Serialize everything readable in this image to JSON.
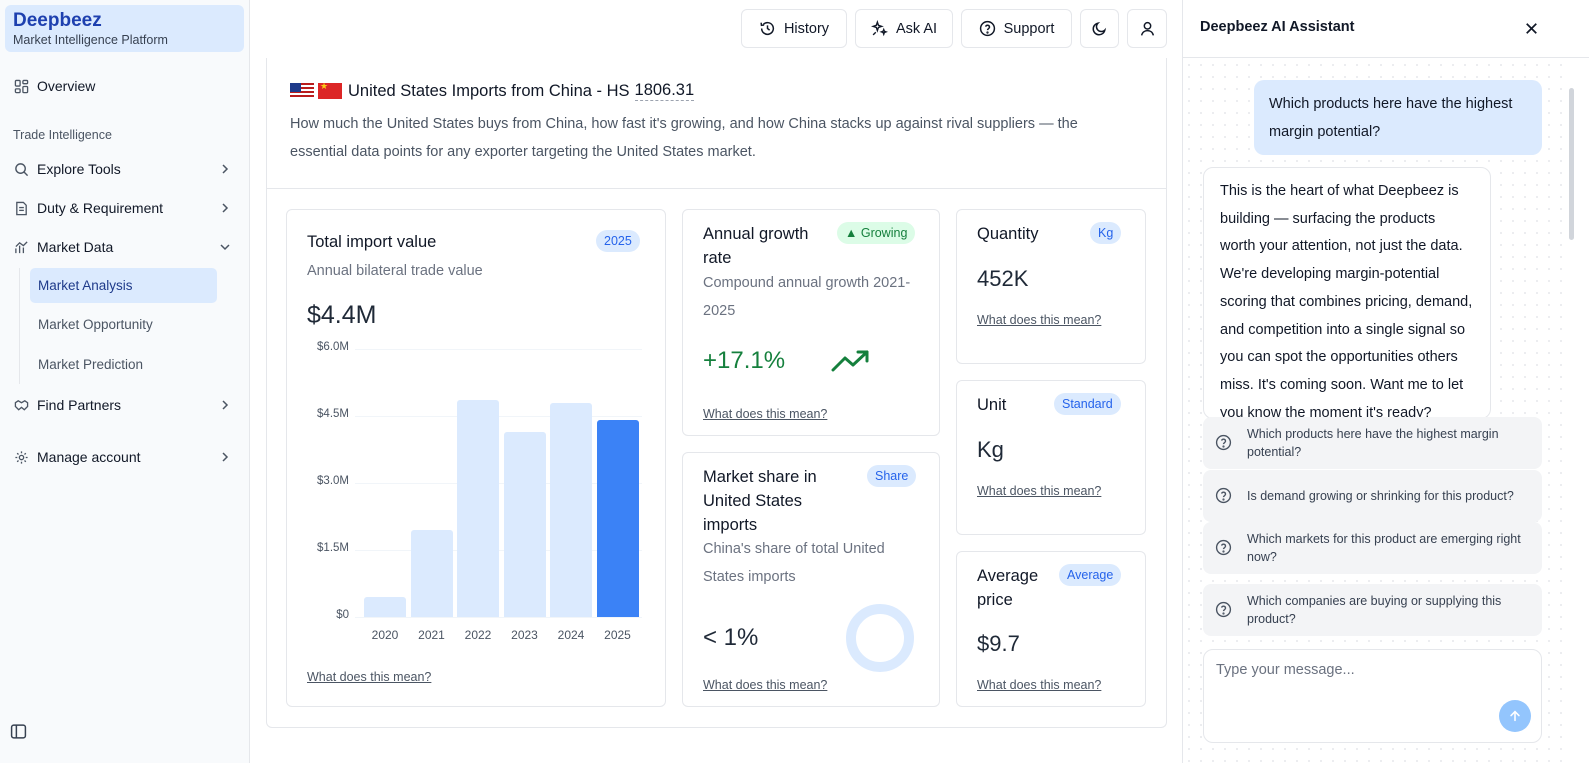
{
  "brand": {
    "name": "Deepbeez",
    "tagline": "Market Intelligence Platform"
  },
  "sidebar": {
    "overview": "Overview",
    "section_label": "Trade Intelligence",
    "items": [
      {
        "label": "Explore Tools",
        "icon": "search-icon",
        "expanded": false
      },
      {
        "label": "Duty & Requirement",
        "icon": "document-icon",
        "expanded": false
      },
      {
        "label": "Market Data",
        "icon": "chart-icon",
        "expanded": true
      },
      {
        "label": "Find Partners",
        "icon": "handshake-icon",
        "expanded": false
      },
      {
        "label": "Manage account",
        "icon": "gear-icon",
        "expanded": false
      }
    ],
    "market_data_subitems": [
      "Market Analysis",
      "Market Opportunity",
      "Market Prediction"
    ],
    "active_subitem": "Market Analysis"
  },
  "topbar": {
    "history": "History",
    "ask_ai": "Ask AI",
    "support": "Support"
  },
  "page": {
    "title": "United States Imports from China - HS",
    "hs_code": "1806.31",
    "description": "How much the United States buys from China, how fast it's growing, and how China stacks up against rival suppliers — the essential data points for any exporter targeting the United States market."
  },
  "cards": {
    "total_import": {
      "title": "Total import value",
      "badge": "2025",
      "subtitle": "Annual bilateral trade value",
      "value": "$4.4M",
      "link": "What does this mean?"
    },
    "growth": {
      "title": "Annual growth rate",
      "badge": "▲ Growing",
      "subtitle": "Compound annual growth 2021-2025",
      "value": "+17.1%",
      "link": "What does this mean?"
    },
    "quantity": {
      "title": "Quantity",
      "badge": "Kg",
      "value": "452K",
      "link": "What does this mean?"
    },
    "unit": {
      "title": "Unit",
      "badge": "Standard",
      "value": "Kg",
      "link": "What does this mean?"
    },
    "market_share": {
      "title": "Market share in United States imports",
      "badge": "Share",
      "subtitle": "China's share of total United States imports",
      "value": "< 1%",
      "link": "What does this mean?"
    },
    "avg_price": {
      "title": "Average price",
      "badge": "Average",
      "value": "$9.7",
      "link": "What does this mean?"
    }
  },
  "chart_data": {
    "type": "bar",
    "categories": [
      "2020",
      "2021",
      "2022",
      "2023",
      "2024",
      "2025"
    ],
    "values": [
      0.45,
      1.95,
      4.85,
      4.15,
      4.8,
      4.4
    ],
    "ylim": [
      0,
      6.0
    ],
    "yticks": [
      "$0",
      "$1.5M",
      "$3.0M",
      "$4.5M",
      "$6.0M"
    ],
    "highlight": "2025",
    "colors": {
      "bar": "#dbeafe",
      "highlight": "#3b82f6"
    },
    "grid": true
  },
  "assistant": {
    "title": "Deepbeez AI Assistant",
    "user_message": "Which products here have the highest margin potential?",
    "bot_message": "This is the heart of what Deepbeez is building — surfacing the products worth your attention, not just the data. We're developing margin-potential scoring that combines pricing, demand, and competition into a single signal so you can spot the opportunities others miss. It's coming soon. Want me to let you know the moment it's ready?",
    "suggestions": [
      "Which products here have the highest margin potential?",
      "Is demand growing or shrinking for this product?",
      "Which markets for this product are emerging right now?",
      "Which companies are buying or supplying this product?"
    ],
    "input_placeholder": "Type your message..."
  }
}
